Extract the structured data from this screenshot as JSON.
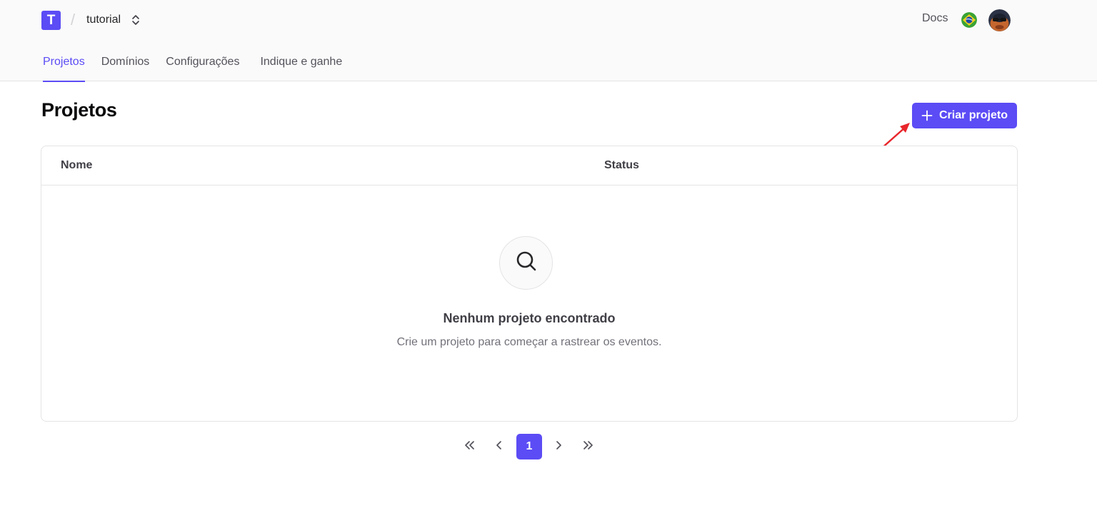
{
  "header": {
    "logo_letter": "T",
    "workspace_name": "tutorial",
    "docs_label": "Docs"
  },
  "tabs": [
    {
      "label": "Projetos",
      "active": true
    },
    {
      "label": "Domínios",
      "active": false
    },
    {
      "label": "Configurações",
      "active": false
    },
    {
      "label": "Indique e ganhe",
      "active": false
    }
  ],
  "main": {
    "title": "Projetos",
    "create_button_label": "Criar projeto"
  },
  "table": {
    "columns": [
      "Nome",
      "Status"
    ],
    "empty_title": "Nenhum projeto encontrado",
    "empty_description": "Crie um projeto para começar a rastrear os eventos."
  },
  "pagination": {
    "current_page": "1"
  },
  "colors": {
    "accent": "#5b4cf5",
    "annotation_arrow": "#e8262b"
  },
  "icons": {
    "workspace_switcher": "chevrons-up-down-icon",
    "language": "brazil-flag-icon",
    "user": "avatar",
    "create": "plus-icon",
    "empty_state": "search-icon",
    "first_page": "chevrons-left-icon",
    "prev_page": "chevron-left-icon",
    "next_page": "chevron-right-icon",
    "last_page": "chevrons-right-icon"
  }
}
